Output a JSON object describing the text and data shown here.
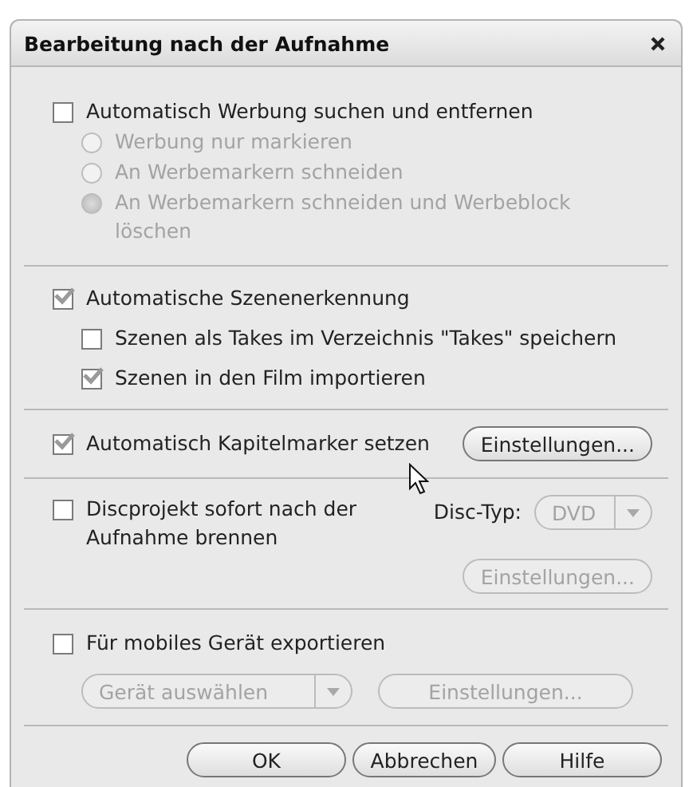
{
  "window": {
    "title": "Bearbeitung nach der Aufnahme"
  },
  "ads": {
    "checkbox": {
      "label": "Automatisch Werbung suchen und entfernen",
      "checked": false
    },
    "options": [
      {
        "label": "Werbung nur markieren",
        "selected": false,
        "disabled": true
      },
      {
        "label": "An Werbemarkern schneiden",
        "selected": false,
        "disabled": true
      },
      {
        "label": "An Werbemarkern schneiden und Werbeblock löschen",
        "selected": true,
        "disabled": true
      }
    ]
  },
  "scenes": {
    "checkbox": {
      "label": "Automatische Szenenerkennung",
      "checked": true
    },
    "options": [
      {
        "label": "Szenen als Takes im Verzeichnis \"Takes\" speichern",
        "checked": false
      },
      {
        "label": "Szenen in den Film importieren",
        "checked": true
      }
    ]
  },
  "chapters": {
    "checkbox": {
      "label": "Automatisch Kapitelmarker setzen",
      "checked": true
    },
    "button": {
      "label": "Einstellungen...",
      "disabled": false
    }
  },
  "disc": {
    "checkbox": {
      "label": "Discprojekt sofort nach der Aufnahme brennen",
      "checked": false
    },
    "type_label": "Disc-Typ:",
    "dropdown": {
      "value": "DVD",
      "disabled": true
    },
    "button": {
      "label": "Einstellungen...",
      "disabled": true
    }
  },
  "mobile": {
    "checkbox": {
      "label": "Für mobiles Gerät exportieren",
      "checked": false
    },
    "dropdown": {
      "value": "Gerät auswählen",
      "disabled": true
    },
    "button": {
      "label": "Einstellungen...",
      "disabled": true
    }
  },
  "buttons": [
    {
      "label": "OK"
    },
    {
      "label": "Abbrechen"
    },
    {
      "label": "Hilfe"
    }
  ]
}
